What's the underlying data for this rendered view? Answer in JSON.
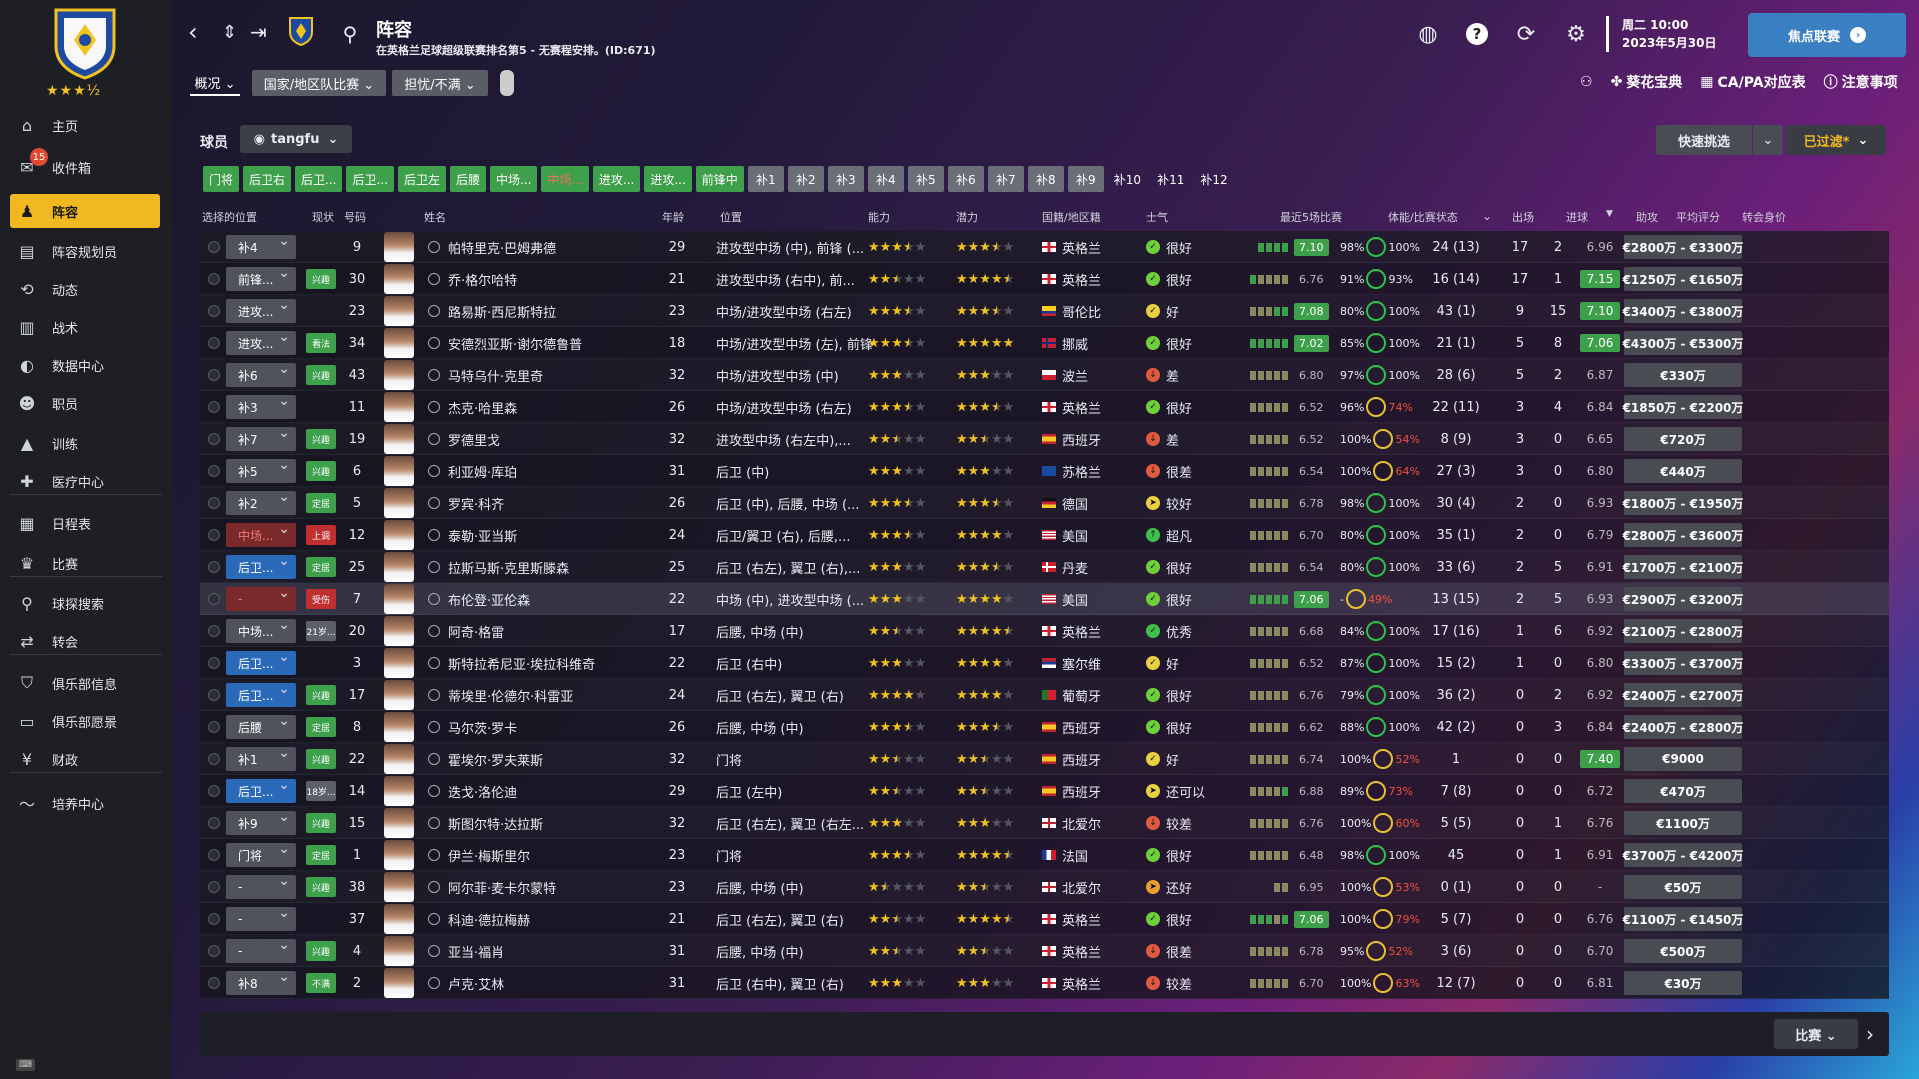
{
  "sidebar": {
    "stars": "★★★½",
    "items": [
      {
        "label": "主页",
        "icon": "home-icon",
        "glyph": "⌂"
      },
      {
        "label": "收件箱",
        "icon": "inbox-icon",
        "glyph": "✉",
        "badge": "15"
      },
      {
        "label": "阵容",
        "icon": "squad-icon",
        "glyph": "♟"
      },
      {
        "label": "阵容规划员",
        "icon": "squad-planner-icon",
        "glyph": "▤"
      },
      {
        "label": "动态",
        "icon": "dynamics-icon",
        "glyph": "⟲"
      },
      {
        "label": "战术",
        "icon": "tactics-icon",
        "glyph": "▥"
      },
      {
        "label": "数据中心",
        "icon": "data-hub-icon",
        "glyph": "◐"
      },
      {
        "label": "职员",
        "icon": "staff-icon",
        "glyph": "☻"
      },
      {
        "label": "训练",
        "icon": "training-icon",
        "glyph": "▲"
      },
      {
        "label": "医疗中心",
        "icon": "medical-icon",
        "glyph": "✚"
      },
      {
        "label": "日程表",
        "icon": "schedule-icon",
        "glyph": "▦"
      },
      {
        "label": "比赛",
        "icon": "trophy-icon",
        "glyph": "♛"
      },
      {
        "label": "球探搜索",
        "icon": "scouting-icon",
        "glyph": "⚲"
      },
      {
        "label": "转会",
        "icon": "transfers-icon",
        "glyph": "⇄"
      },
      {
        "label": "俱乐部信息",
        "icon": "club-info-icon",
        "glyph": "⛉"
      },
      {
        "label": "俱乐部愿景",
        "icon": "club-vision-icon",
        "glyph": "▭"
      },
      {
        "label": "财政",
        "icon": "finance-icon",
        "glyph": "¥"
      },
      {
        "label": "培养中心",
        "icon": "development-icon",
        "glyph": "〜"
      }
    ]
  },
  "header": {
    "title": "阵容",
    "subtitle": "在英格兰足球超级联赛排名第5 - 无赛程安排。(ID:671)",
    "date_line1": "周二 10:00",
    "date_line2": "2023年5月30日",
    "focus_btn": "焦点联赛"
  },
  "toolbar": {
    "dd1": "概况 ⌄",
    "dd2": "国家/地区队比赛 ⌄",
    "dd3": "担忧/不满 ⌄",
    "link1": "葵花宝典",
    "link2": "CA/PA对应表",
    "link3": "注意事项"
  },
  "panel": {
    "label": "球员",
    "view": "tangfu",
    "quick": "快速挑选",
    "filter": "已过滤*"
  },
  "tabs": [
    {
      "t": "门将",
      "c": "g"
    },
    {
      "t": "后卫右",
      "c": "g"
    },
    {
      "t": "后卫...",
      "c": "g"
    },
    {
      "t": "后卫...",
      "c": "g"
    },
    {
      "t": "后卫左",
      "c": "g"
    },
    {
      "t": "后腰",
      "c": "g"
    },
    {
      "t": "中场...",
      "c": "g"
    },
    {
      "t": "中场...",
      "c": "sel"
    },
    {
      "t": "进攻...",
      "c": "g"
    },
    {
      "t": "进攻...",
      "c": "g"
    },
    {
      "t": "前锋中",
      "c": "g"
    },
    {
      "t": "补1",
      "c": "grey"
    },
    {
      "t": "补2",
      "c": "grey"
    },
    {
      "t": "补3",
      "c": "grey"
    },
    {
      "t": "补4",
      "c": "grey"
    },
    {
      "t": "补5",
      "c": "grey"
    },
    {
      "t": "补6",
      "c": "grey"
    },
    {
      "t": "补7",
      "c": "grey"
    },
    {
      "t": "补8",
      "c": "grey"
    },
    {
      "t": "补9",
      "c": "grey"
    },
    {
      "t": "补10",
      "c": "plain"
    },
    {
      "t": "补11",
      "c": "plain"
    },
    {
      "t": "补12",
      "c": "plain"
    }
  ],
  "columns": {
    "select": "选择的位置",
    "status": "现状",
    "num": "号码",
    "name": "姓名",
    "age": "年龄",
    "pos": "位置",
    "ca": "能力",
    "pa": "潜力",
    "nat": "国籍/地区籍",
    "morale": "士气",
    "form": "最近5场比赛",
    "cond": "体能/比赛状态",
    "apps": "出场",
    "gls": "进球",
    "ast": "助攻",
    "rat": "平均评分",
    "val": "转会身价"
  },
  "rows": [
    {
      "sel": "补4",
      "sc": "",
      "st": "",
      "stc": "",
      "num": "9",
      "name": "帕特里克·巴姆弗德",
      "age": "29",
      "pos": "进攻型中场 (中), 前锋 (...",
      "ca": 3.5,
      "pa": 3.5,
      "flag": "eng",
      "nat": "英格兰",
      "mc": "#6fcf3a",
      "mg": "✓",
      "mor": "很好",
      "fb": "gggg",
      "fv": "7.10",
      "fg": true,
      "c1": "98%",
      "c2": "100%",
      "cw": false,
      "apps": "24 (13)",
      "gls": "17",
      "ast": "2",
      "rat": "6.96",
      "rg": false,
      "val": "€2800万 - €3300万"
    },
    {
      "sel": "前锋...",
      "sc": "",
      "st": "兴趣",
      "stc": "st-green",
      "num": "30",
      "name": "乔·格尔哈特",
      "age": "21",
      "pos": "进攻型中场 (右中), 前...",
      "ca": 2.5,
      "pa": 4.5,
      "flag": "eng",
      "nat": "英格兰",
      "mc": "#6fcf3a",
      "mg": "✓",
      "mor": "很好",
      "fb": "goooo",
      "fv": "6.76",
      "fg": false,
      "c1": "91%",
      "c2": "93%",
      "cw": false,
      "apps": "16 (14)",
      "gls": "17",
      "ast": "1",
      "rat": "7.15",
      "rg": true,
      "val": "€1250万 - €1650万"
    },
    {
      "sel": "进攻...",
      "sc": "",
      "st": "",
      "stc": "",
      "num": "23",
      "name": "路易斯·西尼斯特拉",
      "age": "23",
      "pos": "中场/进攻型中场 (右左)",
      "ca": 3.5,
      "pa": 3.5,
      "flag": "col",
      "nat": "哥伦比",
      "mc": "#e8d040",
      "mg": "✓",
      "mor": "好",
      "fb": "ooogg",
      "fv": "7.08",
      "fg": true,
      "c1": "80%",
      "c2": "100%",
      "cw": false,
      "apps": "43 (1)",
      "gls": "9",
      "ast": "15",
      "rat": "7.10",
      "rg": true,
      "val": "€3400万 - €3800万"
    },
    {
      "sel": "进攻...",
      "sc": "",
      "st": "看法",
      "stc": "st-green",
      "num": "34",
      "name": "安德烈亚斯·谢尔德鲁普",
      "age": "18",
      "pos": "中场/进攻型中场 (左), 前锋 (...",
      "ca": 3.5,
      "pa": 5,
      "flag": "nor",
      "nat": "挪威",
      "mc": "#6fcf3a",
      "mg": "✓",
      "mor": "很好",
      "fb": "ggggg",
      "fv": "7.02",
      "fg": true,
      "c1": "85%",
      "c2": "100%",
      "cw": false,
      "apps": "21 (1)",
      "gls": "5",
      "ast": "8",
      "rat": "7.06",
      "rg": true,
      "val": "€4300万 - €5300万"
    },
    {
      "sel": "补6",
      "sc": "",
      "st": "兴趣",
      "stc": "st-green",
      "num": "43",
      "name": "马特乌什·克里奇",
      "age": "32",
      "pos": "中场/进攻型中场 (中)",
      "ca": 3,
      "pa": 3,
      "flag": "pol",
      "nat": "波兰",
      "mc": "#e05a40",
      "mg": "↓",
      "mor": "差",
      "fb": "ooooo",
      "fv": "6.80",
      "fg": false,
      "c1": "97%",
      "c2": "100%",
      "cw": false,
      "apps": "28 (6)",
      "gls": "5",
      "ast": "2",
      "rat": "6.87",
      "rg": false,
      "val": "€330万"
    },
    {
      "sel": "补3",
      "sc": "",
      "st": "",
      "stc": "",
      "num": "11",
      "name": "杰克·哈里森",
      "age": "26",
      "pos": "中场/进攻型中场 (右左)",
      "ca": 3.5,
      "pa": 3.5,
      "flag": "eng",
      "nat": "英格兰",
      "mc": "#6fcf3a",
      "mg": "✓",
      "mor": "很好",
      "fb": "ooooo",
      "fv": "6.52",
      "fg": false,
      "c1": "96%",
      "c2": "74%",
      "cw": true,
      "apps": "22 (11)",
      "gls": "3",
      "ast": "4",
      "rat": "6.84",
      "rg": false,
      "val": "€1850万 - €2200万"
    },
    {
      "sel": "补7",
      "sc": "",
      "st": "兴趣",
      "stc": "st-green",
      "num": "19",
      "name": "罗德里戈",
      "age": "32",
      "pos": "进攻型中场 (右左中),...",
      "ca": 2.5,
      "pa": 2.5,
      "flag": "esp",
      "nat": "西班牙",
      "mc": "#e05a40",
      "mg": "↓",
      "mor": "差",
      "fb": "ooooo",
      "fv": "6.52",
      "fg": false,
      "c1": "100%",
      "c2": "54%",
      "cw": true,
      "apps": "8 (9)",
      "gls": "3",
      "ast": "0",
      "rat": "6.65",
      "rg": false,
      "val": "€720万"
    },
    {
      "sel": "补5",
      "sc": "",
      "st": "兴趣",
      "stc": "st-green",
      "num": "6",
      "name": "利亚姆·库珀",
      "age": "31",
      "pos": "后卫 (中)",
      "ca": 3,
      "pa": 3,
      "flag": "sco",
      "nat": "苏格兰",
      "mc": "#e05a40",
      "mg": "↓",
      "mor": "很差",
      "fb": "ooooo",
      "fv": "6.54",
      "fg": false,
      "c1": "100%",
      "c2": "64%",
      "cw": true,
      "apps": "27 (3)",
      "gls": "3",
      "ast": "0",
      "rat": "6.80",
      "rg": false,
      "val": "€440万"
    },
    {
      "sel": "补2",
      "sc": "",
      "st": "定居",
      "stc": "st-green",
      "num": "5",
      "name": "罗宾·科齐",
      "age": "26",
      "pos": "后卫 (中), 后腰, 中场 (...",
      "ca": 3.5,
      "pa": 3.5,
      "flag": "ger",
      "nat": "德国",
      "mc": "#e8d040",
      "mg": "➤",
      "mor": "较好",
      "fb": "ooooo",
      "fv": "6.78",
      "fg": false,
      "c1": "98%",
      "c2": "100%",
      "cw": false,
      "apps": "30 (4)",
      "gls": "2",
      "ast": "0",
      "rat": "6.93",
      "rg": false,
      "val": "€1800万 - €1950万"
    },
    {
      "sel": "中场...",
      "sc": "red",
      "st": "上调",
      "stc": "st-red",
      "num": "12",
      "name": "泰勒·亚当斯",
      "age": "24",
      "pos": "后卫/翼卫 (右), 后腰,...",
      "ca": 3.5,
      "pa": 4,
      "flag": "usa",
      "nat": "美国",
      "mc": "#3ec04a",
      "mg": "↑",
      "mor": "超凡",
      "fb": "ooooo",
      "fv": "6.70",
      "fg": false,
      "c1": "80%",
      "c2": "100%",
      "cw": false,
      "apps": "35 (1)",
      "gls": "2",
      "ast": "0",
      "rat": "6.79",
      "rg": false,
      "val": "€2800万 - €3600万"
    },
    {
      "sel": "后卫...",
      "sc": "blue",
      "st": "定居",
      "stc": "st-green",
      "num": "25",
      "name": "拉斯马斯·克里斯滕森",
      "age": "25",
      "pos": "后卫 (右左), 翼卫 (右),...",
      "ca": 3,
      "pa": 3.5,
      "flag": "den",
      "nat": "丹麦",
      "mc": "#6fcf3a",
      "mg": "✓",
      "mor": "很好",
      "fb": "ooooo",
      "fv": "6.54",
      "fg": false,
      "c1": "80%",
      "c2": "100%",
      "cw": false,
      "apps": "33 (6)",
      "gls": "2",
      "ast": "5",
      "rat": "6.91",
      "rg": false,
      "val": "€1700万 - €2100万"
    },
    {
      "sel": "-",
      "sc": "red",
      "st": "受伤",
      "stc": "st-red",
      "num": "7",
      "name": "布伦登·亚伦森",
      "age": "22",
      "pos": "中场 (中), 进攻型中场 (...",
      "ca": 3,
      "pa": 4,
      "flag": "usa",
      "nat": "美国",
      "mc": "#6fcf3a",
      "mg": "✓",
      "mor": "很好",
      "fb": "ggggg",
      "fv": "7.06",
      "fg": true,
      "c1": "-",
      "c2": "49%",
      "cw": true,
      "apps": "13 (15)",
      "gls": "2",
      "ast": "5",
      "rat": "6.93",
      "rg": false,
      "val": "€2900万 - €3200万",
      "hl": true
    },
    {
      "sel": "中场...",
      "sc": "",
      "st": "21岁...",
      "stc": "st-grey",
      "num": "20",
      "name": "阿奇·格雷",
      "age": "17",
      "pos": "后腰, 中场 (中)",
      "ca": 2.5,
      "pa": 4.5,
      "flag": "eng",
      "nat": "英格兰",
      "mc": "#3ec04a",
      "mg": "✓",
      "mor": "优秀",
      "fb": "ooooo",
      "fv": "6.68",
      "fg": false,
      "c1": "84%",
      "c2": "100%",
      "cw": false,
      "apps": "17 (16)",
      "gls": "1",
      "ast": "6",
      "rat": "6.92",
      "rg": false,
      "val": "€2100万 - €2800万"
    },
    {
      "sel": "后卫...",
      "sc": "blue",
      "st": "",
      "stc": "",
      "num": "3",
      "name": "斯特拉希尼亚·埃拉科维奇",
      "age": "22",
      "pos": "后卫 (右中)",
      "ca": 3,
      "pa": 4,
      "flag": "srb",
      "nat": "塞尔维",
      "mc": "#e8d040",
      "mg": "✓",
      "mor": "好",
      "fb": "ooooo",
      "fv": "6.52",
      "fg": false,
      "c1": "87%",
      "c2": "100%",
      "cw": false,
      "apps": "15 (2)",
      "gls": "1",
      "ast": "0",
      "rat": "6.80",
      "rg": false,
      "val": "€3300万 - €3700万"
    },
    {
      "sel": "后卫...",
      "sc": "blue",
      "st": "兴趣",
      "stc": "st-green",
      "num": "17",
      "name": "蒂埃里·伦德尔·科雷亚",
      "age": "24",
      "pos": "后卫 (右左), 翼卫 (右)",
      "ca": 4,
      "pa": 4,
      "flag": "por",
      "nat": "葡萄牙",
      "mc": "#6fcf3a",
      "mg": "✓",
      "mor": "很好",
      "fb": "ooooo",
      "fv": "6.76",
      "fg": false,
      "c1": "79%",
      "c2": "100%",
      "cw": false,
      "apps": "36 (2)",
      "gls": "0",
      "ast": "2",
      "rat": "6.92",
      "rg": false,
      "val": "€2400万 - €2700万"
    },
    {
      "sel": "后腰",
      "sc": "",
      "st": "定居",
      "stc": "st-green",
      "num": "8",
      "name": "马尔茨·罗卡",
      "age": "26",
      "pos": "后腰, 中场 (中)",
      "ca": 3.5,
      "pa": 3.5,
      "flag": "esp",
      "nat": "西班牙",
      "mc": "#6fcf3a",
      "mg": "✓",
      "mor": "很好",
      "fb": "ooooo",
      "fv": "6.62",
      "fg": false,
      "c1": "88%",
      "c2": "100%",
      "cw": false,
      "apps": "42 (2)",
      "gls": "0",
      "ast": "3",
      "rat": "6.84",
      "rg": false,
      "val": "€2400万 - €2800万"
    },
    {
      "sel": "补1",
      "sc": "",
      "st": "兴趣",
      "stc": "st-green",
      "num": "22",
      "name": "霍埃尔·罗夫莱斯",
      "age": "32",
      "pos": "门将",
      "ca": 2.5,
      "pa": 2.5,
      "flag": "esp",
      "nat": "西班牙",
      "mc": "#e8d040",
      "mg": "✓",
      "mor": "好",
      "fb": "ooooo",
      "fv": "6.74",
      "fg": false,
      "c1": "100%",
      "c2": "52%",
      "cw": true,
      "apps": "1",
      "gls": "0",
      "ast": "0",
      "rat": "7.40",
      "rg": true,
      "val": "€9000"
    },
    {
      "sel": "后卫...",
      "sc": "blue",
      "st": "18岁...",
      "stc": "st-grey",
      "num": "14",
      "name": "迭戈·洛伦迪",
      "age": "29",
      "pos": "后卫 (左中)",
      "ca": 2.5,
      "pa": 2.5,
      "flag": "esp",
      "nat": "西班牙",
      "mc": "#e8d040",
      "mg": "➤",
      "mor": "还可以",
      "fb": "oooog",
      "fv": "6.88",
      "fg": false,
      "c1": "89%",
      "c2": "73%",
      "cw": true,
      "apps": "7 (8)",
      "gls": "0",
      "ast": "0",
      "rat": "6.72",
      "rg": false,
      "val": "€470万"
    },
    {
      "sel": "补9",
      "sc": "",
      "st": "兴趣",
      "stc": "st-green",
      "num": "15",
      "name": "斯图尔特·达拉斯",
      "age": "32",
      "pos": "后卫 (右左), 翼卫 (右左...",
      "ca": 3,
      "pa": 3,
      "flag": "nir",
      "nat": "北爱尔",
      "mc": "#e05a40",
      "mg": "↓",
      "mor": "较差",
      "fb": "ooooo",
      "fv": "6.76",
      "fg": false,
      "c1": "100%",
      "c2": "60%",
      "cw": true,
      "apps": "5 (5)",
      "gls": "0",
      "ast": "1",
      "rat": "6.76",
      "rg": false,
      "val": "€1100万"
    },
    {
      "sel": "门将",
      "sc": "",
      "st": "定居",
      "stc": "st-green",
      "num": "1",
      "name": "伊兰·梅斯里尔",
      "age": "23",
      "pos": "门将",
      "ca": 3.5,
      "pa": 4.5,
      "flag": "fra",
      "nat": "法国",
      "mc": "#6fcf3a",
      "mg": "✓",
      "mor": "很好",
      "fb": "ooooo",
      "fv": "6.48",
      "fg": false,
      "c1": "98%",
      "c2": "100%",
      "cw": false,
      "apps": "45",
      "gls": "0",
      "ast": "1",
      "rat": "6.91",
      "rg": false,
      "val": "€3700万 - €4200万"
    },
    {
      "sel": "-",
      "sc": "",
      "st": "兴趣",
      "stc": "st-green",
      "num": "38",
      "name": "阿尔菲·麦卡尔蒙特",
      "age": "23",
      "pos": "后腰, 中场 (中)",
      "ca": 1.5,
      "pa": 2.5,
      "flag": "nir",
      "nat": "北爱尔",
      "mc": "#e8a030",
      "mg": "➤",
      "mor": "还好",
      "fb": "oo",
      "fv": "6.95",
      "fg": false,
      "c1": "100%",
      "c2": "53%",
      "cw": true,
      "apps": "0 (1)",
      "gls": "0",
      "ast": "0",
      "rat": "-",
      "rg": false,
      "val": "€50万"
    },
    {
      "sel": "-",
      "sc": "",
      "st": "",
      "stc": "",
      "num": "37",
      "name": "科迪·德拉梅赫",
      "age": "21",
      "pos": "后卫 (右左), 翼卫 (右)",
      "ca": 2.5,
      "pa": 4.5,
      "flag": "eng",
      "nat": "英格兰",
      "mc": "#6fcf3a",
      "mg": "✓",
      "mor": "很好",
      "fb": "gggog",
      "fv": "7.06",
      "fg": true,
      "c1": "100%",
      "c2": "79%",
      "cw": true,
      "apps": "5 (7)",
      "gls": "0",
      "ast": "0",
      "rat": "6.76",
      "rg": false,
      "val": "€1100万 - €1450万"
    },
    {
      "sel": "-",
      "sc": "",
      "st": "兴趣",
      "stc": "st-green",
      "num": "4",
      "name": "亚当·福肖",
      "age": "31",
      "pos": "后腰, 中场 (中)",
      "ca": 2.5,
      "pa": 2.5,
      "flag": "eng",
      "nat": "英格兰",
      "mc": "#e05a40",
      "mg": "↓",
      "mor": "很差",
      "fb": "ooooo",
      "fv": "6.78",
      "fg": false,
      "c1": "95%",
      "c2": "52%",
      "cw": true,
      "apps": "3 (6)",
      "gls": "0",
      "ast": "0",
      "rat": "6.70",
      "rg": false,
      "val": "€500万"
    },
    {
      "sel": "补8",
      "sc": "",
      "st": "不满",
      "stc": "st-green",
      "num": "2",
      "name": "卢克·艾林",
      "age": "31",
      "pos": "后卫 (右中), 翼卫 (右)",
      "ca": 3,
      "pa": 3,
      "flag": "eng",
      "nat": "英格兰",
      "mc": "#e05a40",
      "mg": "↓",
      "mor": "较差",
      "fb": "ooooo",
      "fv": "6.70",
      "fg": false,
      "c1": "100%",
      "c2": "63%",
      "cw": true,
      "apps": "12 (7)",
      "gls": "0",
      "ast": "0",
      "rat": "6.81",
      "rg": false,
      "val": "€30万"
    }
  ],
  "footer": {
    "match_btn": "比赛 ⌄"
  }
}
